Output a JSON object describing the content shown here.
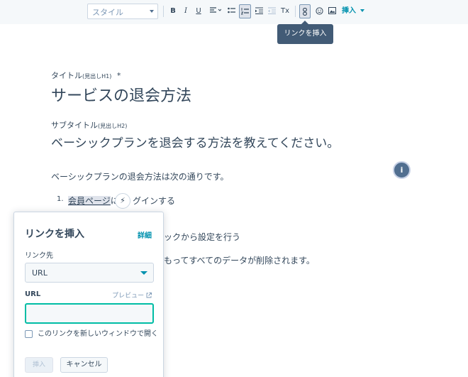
{
  "toolbar": {
    "style_select": "スタイル",
    "bold": "B",
    "italic": "I",
    "underline": "U",
    "clear_format": "Tx",
    "insert_menu": "挿入"
  },
  "tooltip": "リンクを挿入",
  "editor": {
    "title_label": "タイトル",
    "title_hint": "(見出しH1)",
    "title_required": "*",
    "title": "サービスの退会方法",
    "subtitle_label": "サブタイトル",
    "subtitle_hint": "(見出しH2)",
    "subtitle": "ベーシックプランを退会する方法を教えてください。",
    "intro": "ベーシックプランの退会方法は次の通りです。",
    "list_number": "1.",
    "link_text": "会員ページ",
    "step1_visible_a": "に",
    "step1_visible_b": "グインする",
    "step2_visible": "ックから設定を行う",
    "step3_visible": "もってすべてのデータが削除されます。",
    "info_button": "i"
  },
  "link_popover": {
    "title": "リンクを挿入",
    "detail": "詳細",
    "target_label": "リンク先",
    "target_value": "URL",
    "url_label": "URL",
    "preview": "プレビュー",
    "url_value": "",
    "new_window_label": "このリンクを新しいウィンドウで開く",
    "insert_button": "挿入",
    "cancel_button": "キャンセル"
  }
}
